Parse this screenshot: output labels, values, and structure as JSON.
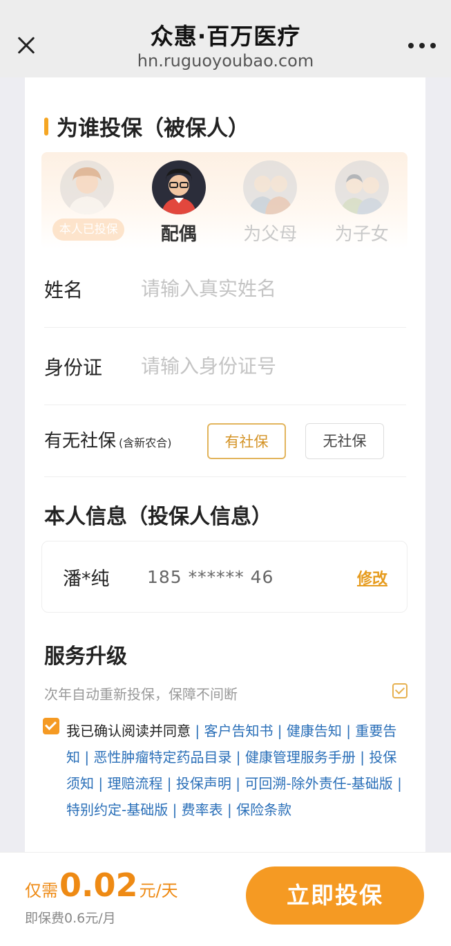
{
  "topbar": {
    "title": "众惠·百万医疗",
    "url": "hn.ruguoyoubao.com"
  },
  "insured_section": {
    "title": "为谁投保（被保人）",
    "relations": [
      {
        "label": "",
        "badge": "本人已投保",
        "state": "disabled"
      },
      {
        "label": "配偶",
        "state": "selected"
      },
      {
        "label": "为父母",
        "state": "disabled"
      },
      {
        "label": "为子女",
        "state": "disabled"
      }
    ],
    "name_label": "姓名",
    "name_placeholder": "请输入真实姓名",
    "id_label": "身份证",
    "id_placeholder": "请输入身份证号",
    "social_label": "有无社保",
    "social_note": "(含新农合)",
    "social_yes": "有社保",
    "social_no": "无社保"
  },
  "holder_section": {
    "title": "本人信息（投保人信息）",
    "name": "潘*纯",
    "phone": "185 ****** 46",
    "edit_label": "修改"
  },
  "service_section": {
    "title": "服务升级",
    "auto_renew": "次年自动重新投保，保障不间断",
    "auto_renew_checked": true
  },
  "agreement": {
    "checked": true,
    "lead": "我已确认阅读并同意",
    "docs": [
      "客户告知书",
      "健康告知",
      "重要告知",
      "恶性肿瘤特定药品目录",
      "健康管理服务手册",
      "投保须知",
      "理赔流程",
      "投保声明",
      "可回溯-除外责任-基础版",
      "特别约定-基础版",
      "费率表",
      "保险条款"
    ]
  },
  "footer": {
    "price_prefix": "仅需",
    "price_value": "0.02",
    "price_unit": "元/天",
    "monthly": "即保费0.6元/月",
    "cta": "立即投保"
  },
  "colors": {
    "accent": "#f59a23",
    "link": "#2a6fb8"
  }
}
